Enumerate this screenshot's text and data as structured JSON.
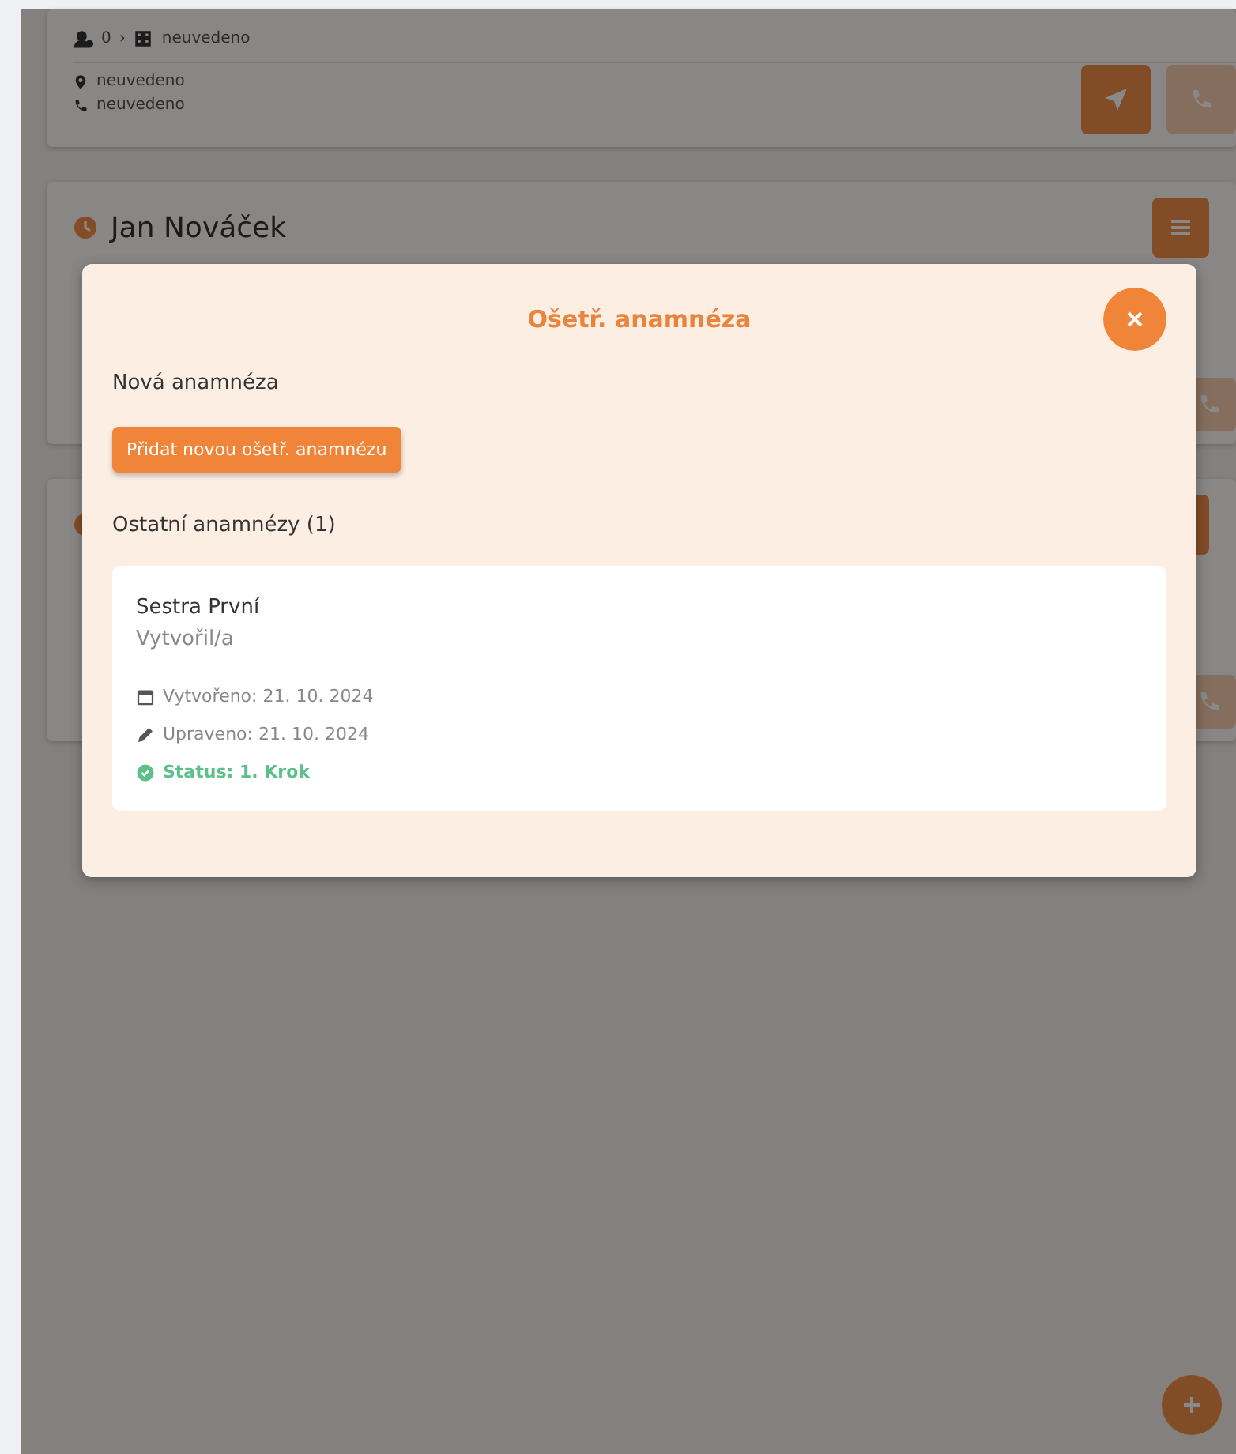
{
  "background": {
    "place": {
      "count": "0",
      "separator": "›",
      "room": "neuvedeno",
      "address": "neuvedeno",
      "phone": "neuvedeno"
    },
    "patients": [
      {
        "kind": "patient",
        "name": "Jan Nováček"
      },
      {
        "kind": "patient"
      }
    ]
  },
  "modal": {
    "title": "Ošetř. anamnéza",
    "new_section": "Nová anamnéza",
    "add_button": "Přidat novou ošetř. anamnézu",
    "others_heading": "Ostatní anamnézy (1)",
    "records": [
      {
        "author": "Sestra První",
        "role": "Vytvořil/a",
        "created": "Vytvořeno: 21. 10. 2024",
        "updated": "Upraveno: 21. 10. 2024",
        "status": "Status: 1. Krok",
        "color": "#5cc08a"
      }
    ]
  }
}
